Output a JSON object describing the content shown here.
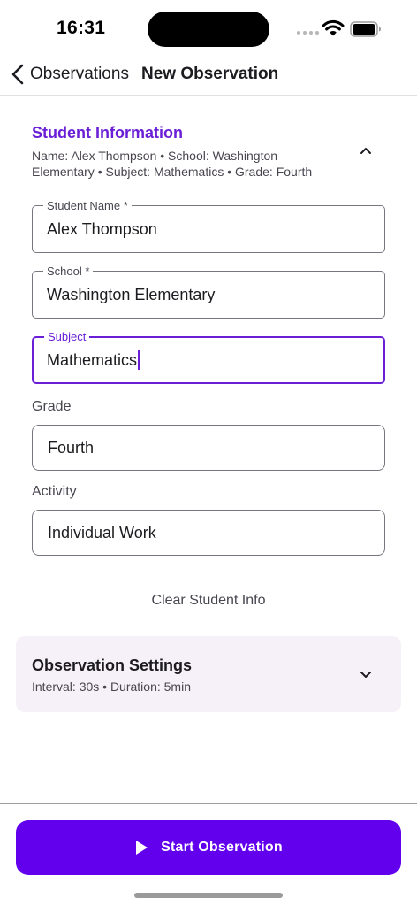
{
  "status_bar": {
    "time": "16:31"
  },
  "nav": {
    "back_label": "Observations",
    "title": "New Observation"
  },
  "student_info": {
    "title": "Student Information",
    "summary": "Name: Alex Thompson • School: Washington Elementary • Subject: Mathematics • Grade: Fourth",
    "fields": {
      "name": {
        "label": "Student Name *",
        "value": "Alex Thompson"
      },
      "school": {
        "label": "School *",
        "value": "Washington Elementary"
      },
      "subject": {
        "label": "Subject",
        "value": "Mathematics"
      },
      "grade": {
        "label": "Grade",
        "value": "Fourth"
      },
      "activity": {
        "label": "Activity",
        "value": "Individual Work"
      }
    },
    "clear_label": "Clear Student Info"
  },
  "settings": {
    "title": "Observation Settings",
    "summary": "Interval: 30s • Duration: 5min"
  },
  "actions": {
    "start_label": "Start Observation"
  },
  "colors": {
    "accent": "#6a1fd6",
    "primary_button": "#6200ee",
    "card_bg": "#f6f1f8"
  },
  "icons": {
    "back": "chevron-left-icon",
    "collapse": "chevron-up-icon",
    "expand": "chevron-down-icon",
    "start": "play-icon"
  }
}
